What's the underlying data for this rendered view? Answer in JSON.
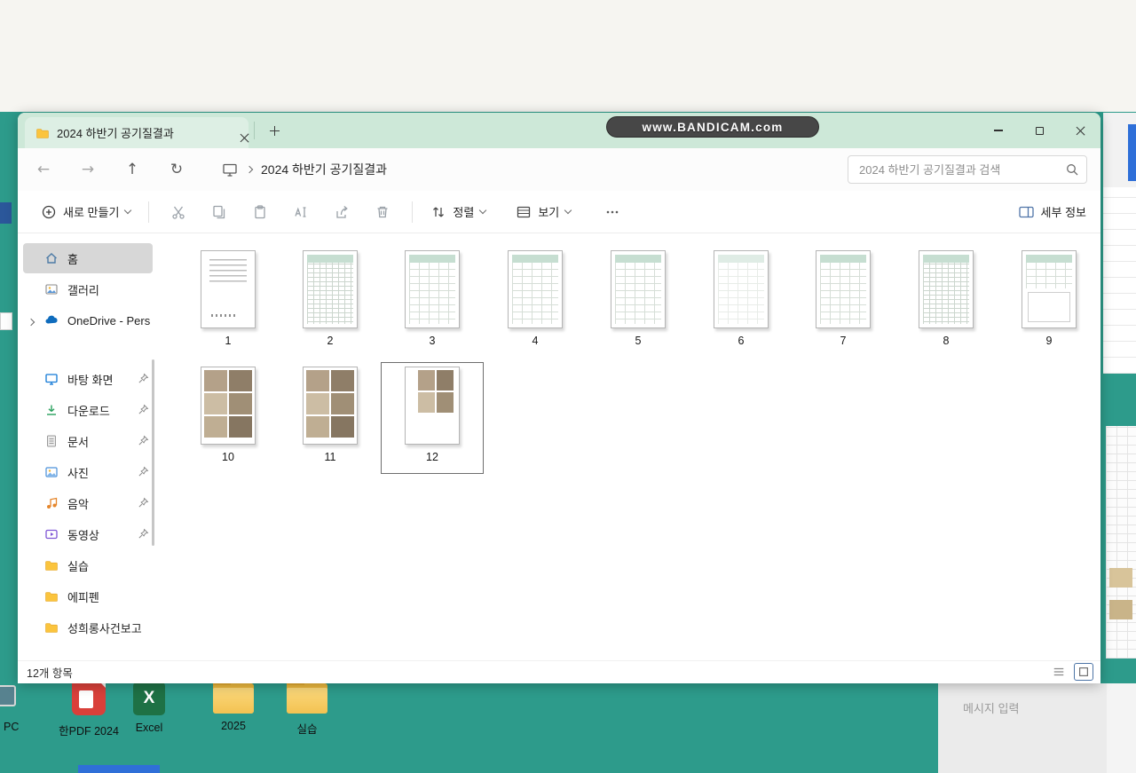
{
  "watermark": {
    "text": "www.BANDICAM.com"
  },
  "explorer": {
    "tab": {
      "title": "2024 하반기 공기질결과"
    },
    "breadcrumb": {
      "path": "2024 하반기 공기질결과"
    },
    "search": {
      "placeholder": "2024 하반기 공기질결과 검색"
    },
    "toolbar": {
      "new_label": "새로 만들기",
      "sort_label": "정렬",
      "view_label": "보기",
      "details_label": "세부 정보"
    },
    "sidebar": {
      "items": [
        {
          "label": "홈"
        },
        {
          "label": "갤러리"
        },
        {
          "label": "OneDrive - Pers"
        },
        {
          "label": "바탕 화면"
        },
        {
          "label": "다운로드"
        },
        {
          "label": "문서"
        },
        {
          "label": "사진"
        },
        {
          "label": "음악"
        },
        {
          "label": "동영상"
        },
        {
          "label": "실습"
        },
        {
          "label": "에피펜"
        },
        {
          "label": "성희롱사건보고"
        }
      ]
    },
    "files": [
      {
        "name": "1",
        "kind": "doc"
      },
      {
        "name": "2",
        "kind": "table-dense"
      },
      {
        "name": "3",
        "kind": "table"
      },
      {
        "name": "4",
        "kind": "table"
      },
      {
        "name": "5",
        "kind": "table"
      },
      {
        "name": "6",
        "kind": "table-light"
      },
      {
        "name": "7",
        "kind": "table"
      },
      {
        "name": "8",
        "kind": "table-dense"
      },
      {
        "name": "9",
        "kind": "table-split"
      },
      {
        "name": "10",
        "kind": "photo"
      },
      {
        "name": "11",
        "kind": "photo"
      },
      {
        "name": "12",
        "kind": "photo-split",
        "selected": true
      }
    ],
    "statusbar": {
      "count": "12개 항목"
    }
  },
  "desktop": {
    "icons": [
      {
        "label": "한PDF 2024"
      },
      {
        "label": "Excel",
        "glyph": "X"
      },
      {
        "label": "2025"
      },
      {
        "label": "실습"
      }
    ],
    "pc_label": "PC"
  },
  "chat": {
    "input_placeholder": "메시지 입력"
  },
  "colors": {
    "desktop": "#2d9b8b",
    "tabbar": "#cde8d8",
    "accent": "#0a6cbd",
    "selection_border": "#6e6e6e"
  }
}
